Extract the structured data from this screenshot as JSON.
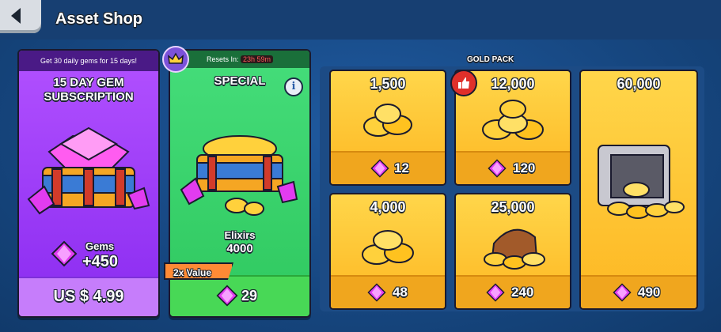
{
  "header": {
    "title": "Asset Shop"
  },
  "subscription": {
    "banner": "Get 30 daily gems for 15 days!",
    "title_line1": "15 DAY GEM",
    "title_line2": "SUBSCRIPTION",
    "gems_label": "Gems",
    "gems_amount": "+450",
    "price": "US $ 4.99"
  },
  "special": {
    "resets_label": "Resets In:",
    "resets_timer": "23h 59m",
    "title": "SPECIAL",
    "item_label": "Elixirs",
    "item_amount": "4000",
    "value_badge": "2x Value",
    "price": "29"
  },
  "gold_pack": {
    "label": "GOLD PACK",
    "items": [
      {
        "amount": "1,500",
        "price": "12"
      },
      {
        "amount": "12,000",
        "price": "120"
      },
      {
        "amount": "60,000",
        "price": "490"
      },
      {
        "amount": "4,000",
        "price": "48"
      },
      {
        "amount": "25,000",
        "price": "240"
      }
    ]
  },
  "colors": {
    "gem": "#e23cf0",
    "gold": "#ffc934",
    "background": "#16467f"
  },
  "icons": [
    "back-arrow-icon",
    "gem-icon",
    "info-icon",
    "crown-icon",
    "thumbs-up-icon",
    "coins-icon",
    "vault-icon",
    "chest-icon"
  ]
}
